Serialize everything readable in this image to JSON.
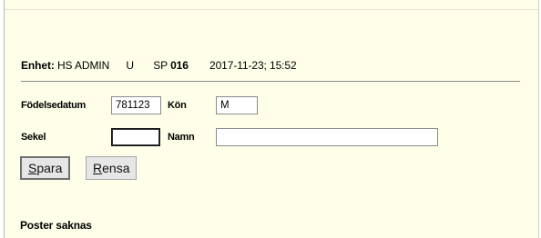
{
  "header": {
    "unit_label": "Enhet:",
    "unit_value": "HS ADMIN",
    "u_flag": "U",
    "sp_label": "SP",
    "sp_value": "016",
    "datetime": "2017-11-23; 15:52"
  },
  "form": {
    "birthdate_label": "Födelsedatum",
    "birthdate_value": "781123",
    "gender_label": "Kön",
    "gender_value": "M",
    "century_label": "Sekel",
    "century_value": "",
    "name_label": "Namn",
    "name_value": ""
  },
  "buttons": {
    "save": {
      "access_key": "S",
      "rest": "para"
    },
    "clear": {
      "access_key": "R",
      "rest": "ensa"
    }
  },
  "status_text": "Poster saknas"
}
